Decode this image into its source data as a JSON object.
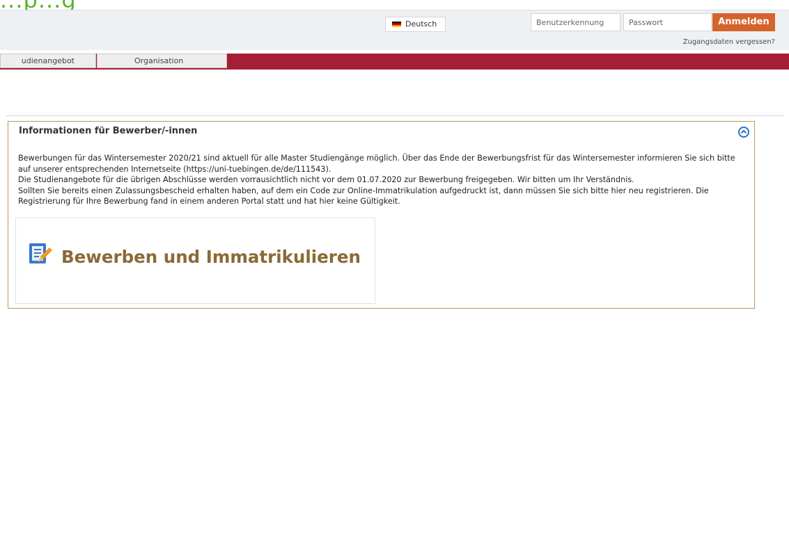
{
  "header": {
    "logo_text": "...p...g",
    "language_button": {
      "label": "Deutsch",
      "flag_icon": "german-flag-icon"
    },
    "login": {
      "username_placeholder": "Benutzerkennung",
      "password_placeholder": "Passwort",
      "submit_label": "Anmelden",
      "forgot_link": "Zugangsdaten vergessen?"
    }
  },
  "nav": {
    "tabs": [
      {
        "label": "udienangebot"
      },
      {
        "label": "Organisation"
      }
    ]
  },
  "infobox": {
    "title": "Informationen für Bewerber/-innen",
    "collapse_icon": "chevron-up-circle-icon",
    "paragraphs": [
      "Bewerbungen für das Wintersemester 2020/21 sind aktuell für alle Master Studiengänge möglich. Über das Ende der Bewerbungsfrist für das Wintersemester informieren Sie sich bitte auf unserer entsprechenden Internetseite (https://uni-tuebingen.de/de/111543).",
      "Die Studienangebote für die übrigen Abschlüsse werden vorrausichtlich nicht vor dem 01.07.2020 zur Bewerbung freigegeben. Wir bitten um Ihr Verständnis.",
      "Sollten Sie bereits einen Zulassungsbescheid erhalten haben, auf dem ein Code zur Online-Immatrikulation aufgedruckt ist, dann müssen Sie sich bitte hier neu registrieren. Die Registrierung für Ihre Bewerbung fand in einem anderen Portal statt und hat hier keine Gültigkeit."
    ],
    "apply_card": {
      "label": "Bewerben und Immatrikulieren",
      "icon": "edit-document-icon"
    }
  },
  "colors": {
    "accent_bar": "#a51e36",
    "login_button": "#d5632c",
    "box_border": "#b89a5e",
    "card_title": "#8a6a36"
  }
}
